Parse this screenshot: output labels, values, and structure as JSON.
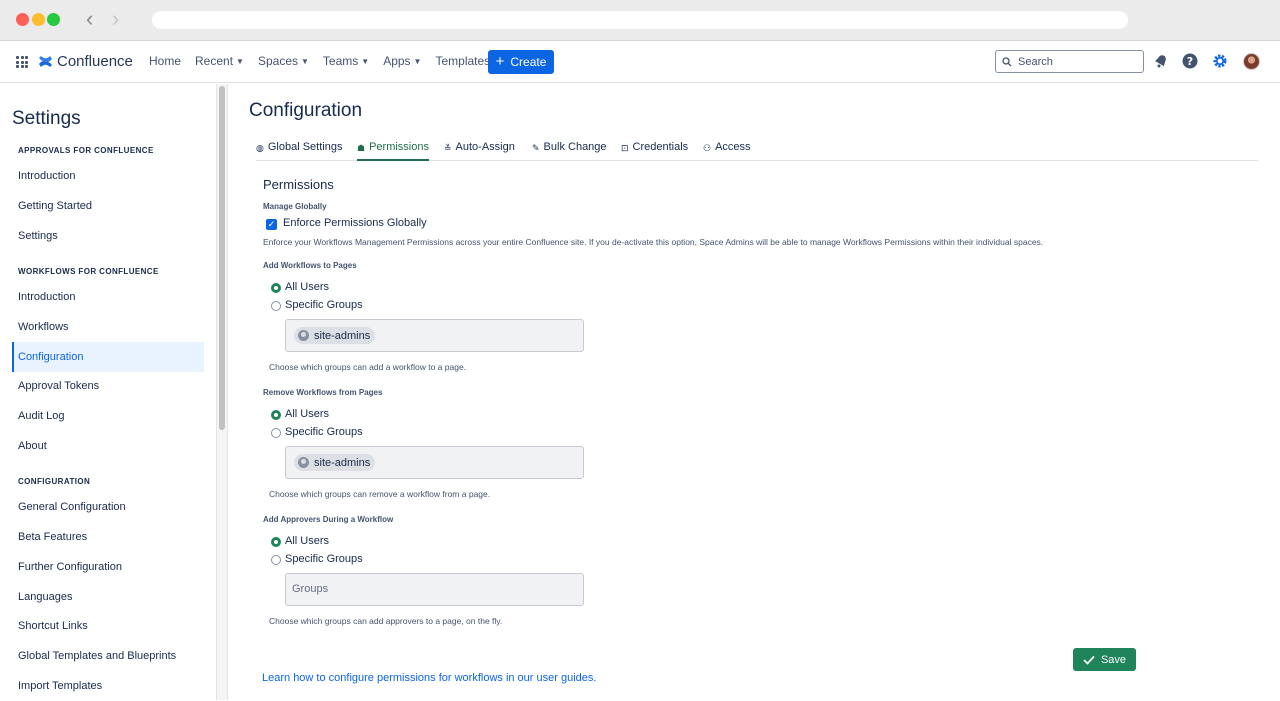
{
  "topnav": {
    "logo_text": "Confluence",
    "links": [
      {
        "label": "Home",
        "dropdown": false
      },
      {
        "label": "Recent",
        "dropdown": true
      },
      {
        "label": "Spaces",
        "dropdown": true
      },
      {
        "label": "Teams",
        "dropdown": true
      },
      {
        "label": "Apps",
        "dropdown": true
      },
      {
        "label": "Templates",
        "dropdown": false
      }
    ],
    "create_label": "Create",
    "search_placeholder": "Search"
  },
  "sidebar": {
    "title": "Settings",
    "sections": [
      {
        "heading": "APPROVALS FOR CONFLUENCE",
        "items": [
          "Introduction",
          "Getting Started",
          "Settings"
        ]
      },
      {
        "heading": "WORKFLOWS FOR CONFLUENCE",
        "items": [
          "Introduction",
          "Workflows",
          "Configuration",
          "Approval Tokens",
          "Audit Log",
          "About"
        ]
      },
      {
        "heading": "CONFIGURATION",
        "items": [
          "General Configuration",
          "Beta Features",
          "Further Configuration",
          "Languages",
          "Shortcut Links",
          "Global Templates and Blueprints",
          "Import Templates"
        ]
      }
    ],
    "active_item": "Configuration"
  },
  "main": {
    "title": "Configuration",
    "tabs": [
      {
        "label": "Global Settings",
        "icon": "globe-icon"
      },
      {
        "label": "Permissions",
        "icon": "people-icon",
        "active": true
      },
      {
        "label": "Auto-Assign",
        "icon": "sliders-icon"
      },
      {
        "label": "Bulk Change",
        "icon": "pencil-icon"
      },
      {
        "label": "Credentials",
        "icon": "lock-icon"
      },
      {
        "label": "Access",
        "icon": "user-lock-icon"
      }
    ],
    "permissions": {
      "heading": "Permissions",
      "manage_globally_label": "Manage Globally",
      "enforce_label": "Enforce Permissions Globally",
      "enforce_checked": true,
      "enforce_desc": "Enforce your Workflows Management Permissions across your entire Confluence site. If you de-activate this option, Space Admins will be able to manage Workflows Permissions within their individual spaces.",
      "blocks": [
        {
          "label": "Add Workflows to Pages",
          "all_users": "All Users",
          "specific_groups": "Specific Groups",
          "selected": "all",
          "chip": "site-admins",
          "placeholder": "",
          "hint": "Choose which groups can add a workflow to a page."
        },
        {
          "label": "Remove Workflows from Pages",
          "all_users": "All Users",
          "specific_groups": "Specific Groups",
          "selected": "all",
          "chip": "site-admins",
          "placeholder": "",
          "hint": "Choose which groups can remove a workflow from a page."
        },
        {
          "label": "Add Approvers During a Workflow",
          "all_users": "All Users",
          "specific_groups": "Specific Groups",
          "selected": "all",
          "chip": "",
          "placeholder": "Groups",
          "hint": "Choose which groups can add approvers to a page, on the fly."
        }
      ]
    },
    "save_label": "Save",
    "learn_link": "Learn how to configure permissions for workflows in our user guides."
  },
  "colors": {
    "primary": "#0c66e4",
    "success": "#1f845a",
    "text": "#172b4d"
  }
}
